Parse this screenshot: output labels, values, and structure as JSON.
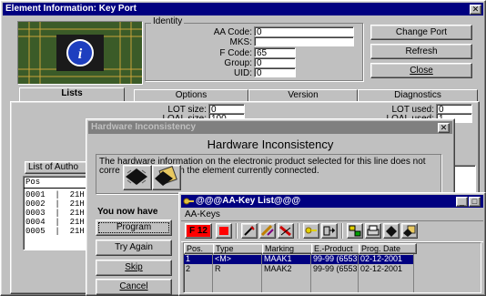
{
  "main_window": {
    "title": "Element Information: Key Port",
    "close_glyph": "✕",
    "identity": {
      "group_label": "Identity",
      "aa_code_label": "AA Code:",
      "aa_code_value": "0",
      "mks_label": "MKS:",
      "mks_value": "",
      "f_code_label": "F Code:",
      "f_code_value": "65",
      "group_field_label": "Group:",
      "group_value": "0",
      "uid_label": "UID:",
      "uid_value": "0"
    },
    "buttons": {
      "change_port": "Change Port",
      "refresh": "Refresh",
      "close": "Close"
    },
    "tabs": [
      "Lists",
      "Options",
      "Version",
      "Diagnostics"
    ],
    "lists_panel": {
      "lot_size_label": "LOT size:",
      "lot_size_value": "0",
      "loal_size_label": "LOAL size:",
      "loal_size_value": "100",
      "lot_used_label": "LOT used:",
      "lot_used_value": "0",
      "loal_used_label": "LOAL used:",
      "loal_used_value": "1",
      "list_of_auth_label": "List of Autho",
      "list_header": "Pos",
      "list_rows": [
        "0001  |  21H",
        "0002  |  21H",
        "0003  |  21H",
        "0004  |  21H",
        "0005  |  21H"
      ]
    }
  },
  "dialog": {
    "title": "Hardware Inconsistency",
    "close_glyph": "✕",
    "heading": "Hardware Inconsistency",
    "message_line1": "The hardware information on the electronic product selected for this line does not",
    "message_line2_a": "corre",
    "message_line2_b": "in the element currently connected.",
    "you_now_have": "You now have",
    "buttons": {
      "program": "Program",
      "try_again": "Try Again",
      "skip": "Skip",
      "cancel": "Cancel"
    }
  },
  "keylist_window": {
    "title": "@@@AA-Key List@@@",
    "menu_label": "AA-Keys",
    "f12_label": "F 12",
    "minimize_glyph": "_",
    "maximize_glyph": "□",
    "columns": [
      "Pos.",
      "Type",
      "Marking",
      "E.-Product",
      "Prog. Date"
    ],
    "rows": [
      {
        "pos": "1",
        "type": "<M>",
        "marking": "MAAK1",
        "product": "99-99 (6553!",
        "date": "02-12-2001"
      },
      {
        "pos": "2",
        "type": "R",
        "marking": "MAAK2",
        "product": "99-99 (6553!",
        "date": "02-12-2001"
      }
    ]
  },
  "colors": {
    "title_active": "#000080",
    "title_inactive": "#808080",
    "face": "#c0c0c0",
    "selection": "#000080",
    "f12_red": "#ff0000"
  }
}
